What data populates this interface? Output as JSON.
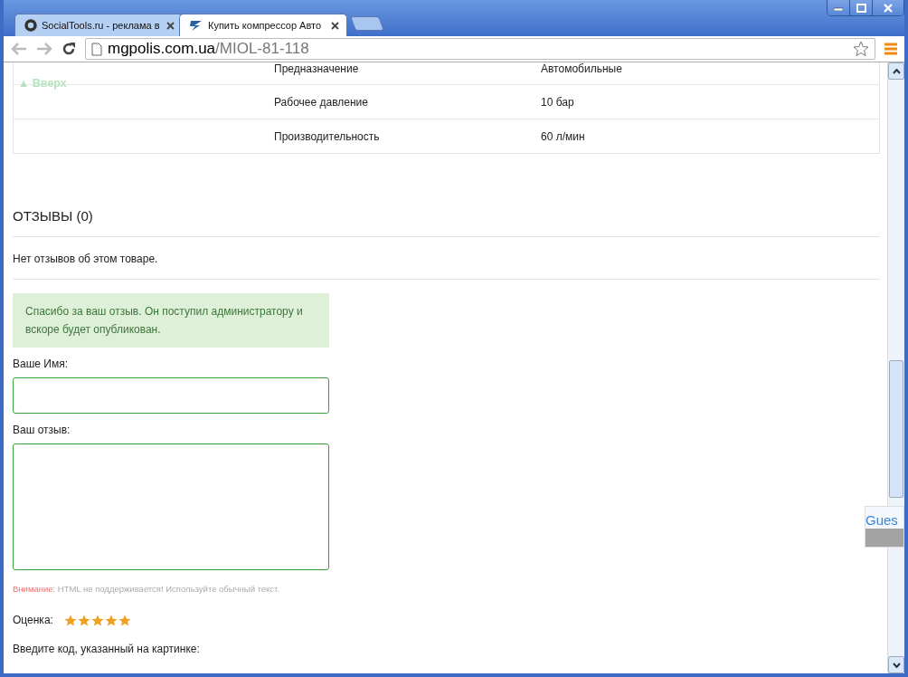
{
  "tabs": [
    {
      "title": "SocialTools.ru - реклама в",
      "selected": false
    },
    {
      "title": "Купить компрессор Авто",
      "selected": true
    }
  ],
  "address": {
    "host": "mgpolis.com.ua",
    "path": "/MIOL-81-118"
  },
  "back_to_top": "▲ Вверх",
  "specs": [
    {
      "name": "Предназначение",
      "value": "Автомобильные"
    },
    {
      "name": "Рабочее давление",
      "value": "10 бар"
    },
    {
      "name": "Производительность",
      "value": "60 л/мин"
    }
  ],
  "reviews": {
    "heading": "ОТЗЫВЫ (0)",
    "empty": "Нет отзывов об этом товаре.",
    "success": "Спасибо за ваш отзыв. Он поступил администратору и вскоре будет опубликован.",
    "name_label": "Ваше Имя:",
    "review_label": "Ваш отзыв:",
    "warning_label": "Внимание:",
    "warning_text": "HTML не поддерживается! Используйте обычный текст.",
    "rating_label": "Оценка:",
    "stars": 5,
    "captcha_label": "Введите код, указанный на картинке:"
  },
  "widget": {
    "label": "Gues"
  }
}
